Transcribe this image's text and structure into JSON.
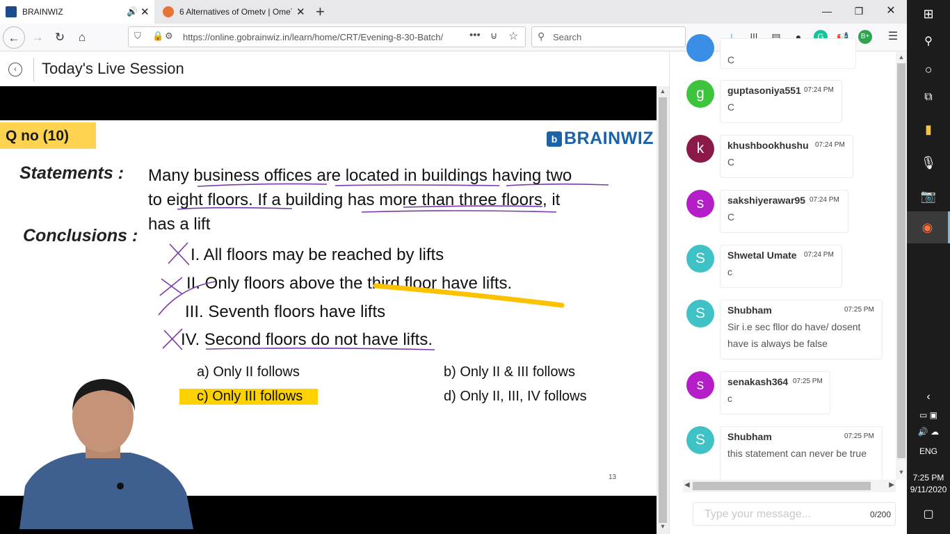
{
  "browser": {
    "tabs": [
      {
        "title": "BRAINWIZ",
        "favicon_color": "#1a4b8c",
        "active": true
      },
      {
        "title": "6 Alternatives of Ometv | OmeT",
        "favicon_color": "#e8733a",
        "active": false
      }
    ],
    "url": "https://online.gobrainwiz.in/learn/home/CRT/Evening-8-30-Batch/",
    "search_placeholder": "Search"
  },
  "page": {
    "title": "Today's Live Session"
  },
  "slide": {
    "qno": "Q no (10)",
    "logo": "BRAINWIZ",
    "statements_label": "Statements :",
    "statement_line1": "Many business offices are located in buildings having two",
    "statement_line2": "to eight floors. If a building has more than three floors, it",
    "statement_line3": "has a lift",
    "conclusions_label": "Conclusions :",
    "conclusions": [
      "I. All floors may be reached by lifts",
      "II. Only floors above the third floor have lifts.",
      "III. Seventh floors have lifts",
      "IV. Second floors do not have lifts."
    ],
    "options": {
      "a": "a) Only II follows",
      "b": "b) Only II & III follows",
      "c": "c) Only III follows",
      "d": "d) Only II, III, IV follows"
    },
    "page_number": "13"
  },
  "chat": {
    "messages": [
      {
        "user": "",
        "avatar": "",
        "color": "#3a8ee6",
        "time": "",
        "text": "C"
      },
      {
        "user": "guptasoniya551",
        "avatar": "g",
        "color": "#3cc43c",
        "time": "07:24 PM",
        "text": "C"
      },
      {
        "user": "khushbookhushu",
        "avatar": "k",
        "color": "#8b1a4a",
        "time": "07:24 PM",
        "text": "C"
      },
      {
        "user": "sakshiyerawar95",
        "avatar": "s",
        "color": "#b51dc9",
        "time": "07:24 PM",
        "text": "C"
      },
      {
        "user": "Shwetal Umate",
        "avatar": "S",
        "color": "#3ec2c5",
        "time": "07:24 PM",
        "text": "c"
      },
      {
        "user": "Shubham",
        "avatar": "S",
        "color": "#3ec2c5",
        "time": "07:25 PM",
        "text": "Sir i.e sec fllor do have/ dosent have is always be false"
      },
      {
        "user": "senakash364",
        "avatar": "s",
        "color": "#b51dc9",
        "time": "07:25 PM",
        "text": "c"
      },
      {
        "user": "Shubham",
        "avatar": "S",
        "color": "#3ec2c5",
        "time": "07:25 PM",
        "text": "this statement can never be true"
      }
    ],
    "input_placeholder": "Type your message...",
    "char_count": "0/200"
  },
  "taskbar": {
    "language": "ENG",
    "time": "7:25 PM",
    "date": "9/11/2020"
  }
}
